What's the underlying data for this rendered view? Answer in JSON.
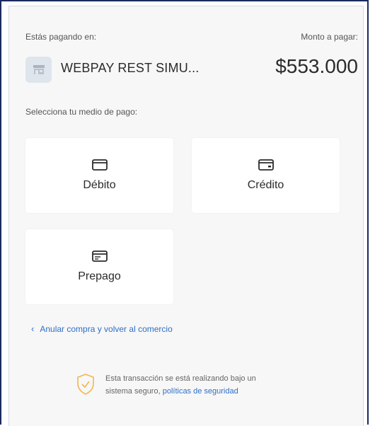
{
  "header": {
    "paying_label": "Estás pagando en:",
    "amount_label": "Monto a pagar:",
    "merchant_name": "WEBPAY REST SIMU...",
    "merchant_icon": "store-icon",
    "amount": "$553.000"
  },
  "payment": {
    "select_label": "Selecciona tu medio de pago:",
    "methods": [
      {
        "label": "Débito",
        "icon": "debit-card-icon"
      },
      {
        "label": "Crédito",
        "icon": "credit-card-icon"
      },
      {
        "label": "Prepago",
        "icon": "prepaid-card-icon"
      }
    ]
  },
  "footer": {
    "back_link": "Anular compra y volver al comercio",
    "secure_line1": "Esta transacción se está realizando bajo un",
    "secure_line2_prefix": "sistema seguro, ",
    "secure_link": "políticas de seguridad",
    "secure_icon": "shield-check-icon"
  },
  "colors": {
    "frame_border": "#1a2a5e",
    "link": "#2f6fc4",
    "shield": "#f2b64a",
    "panel_bg": "#f7f7f8"
  }
}
